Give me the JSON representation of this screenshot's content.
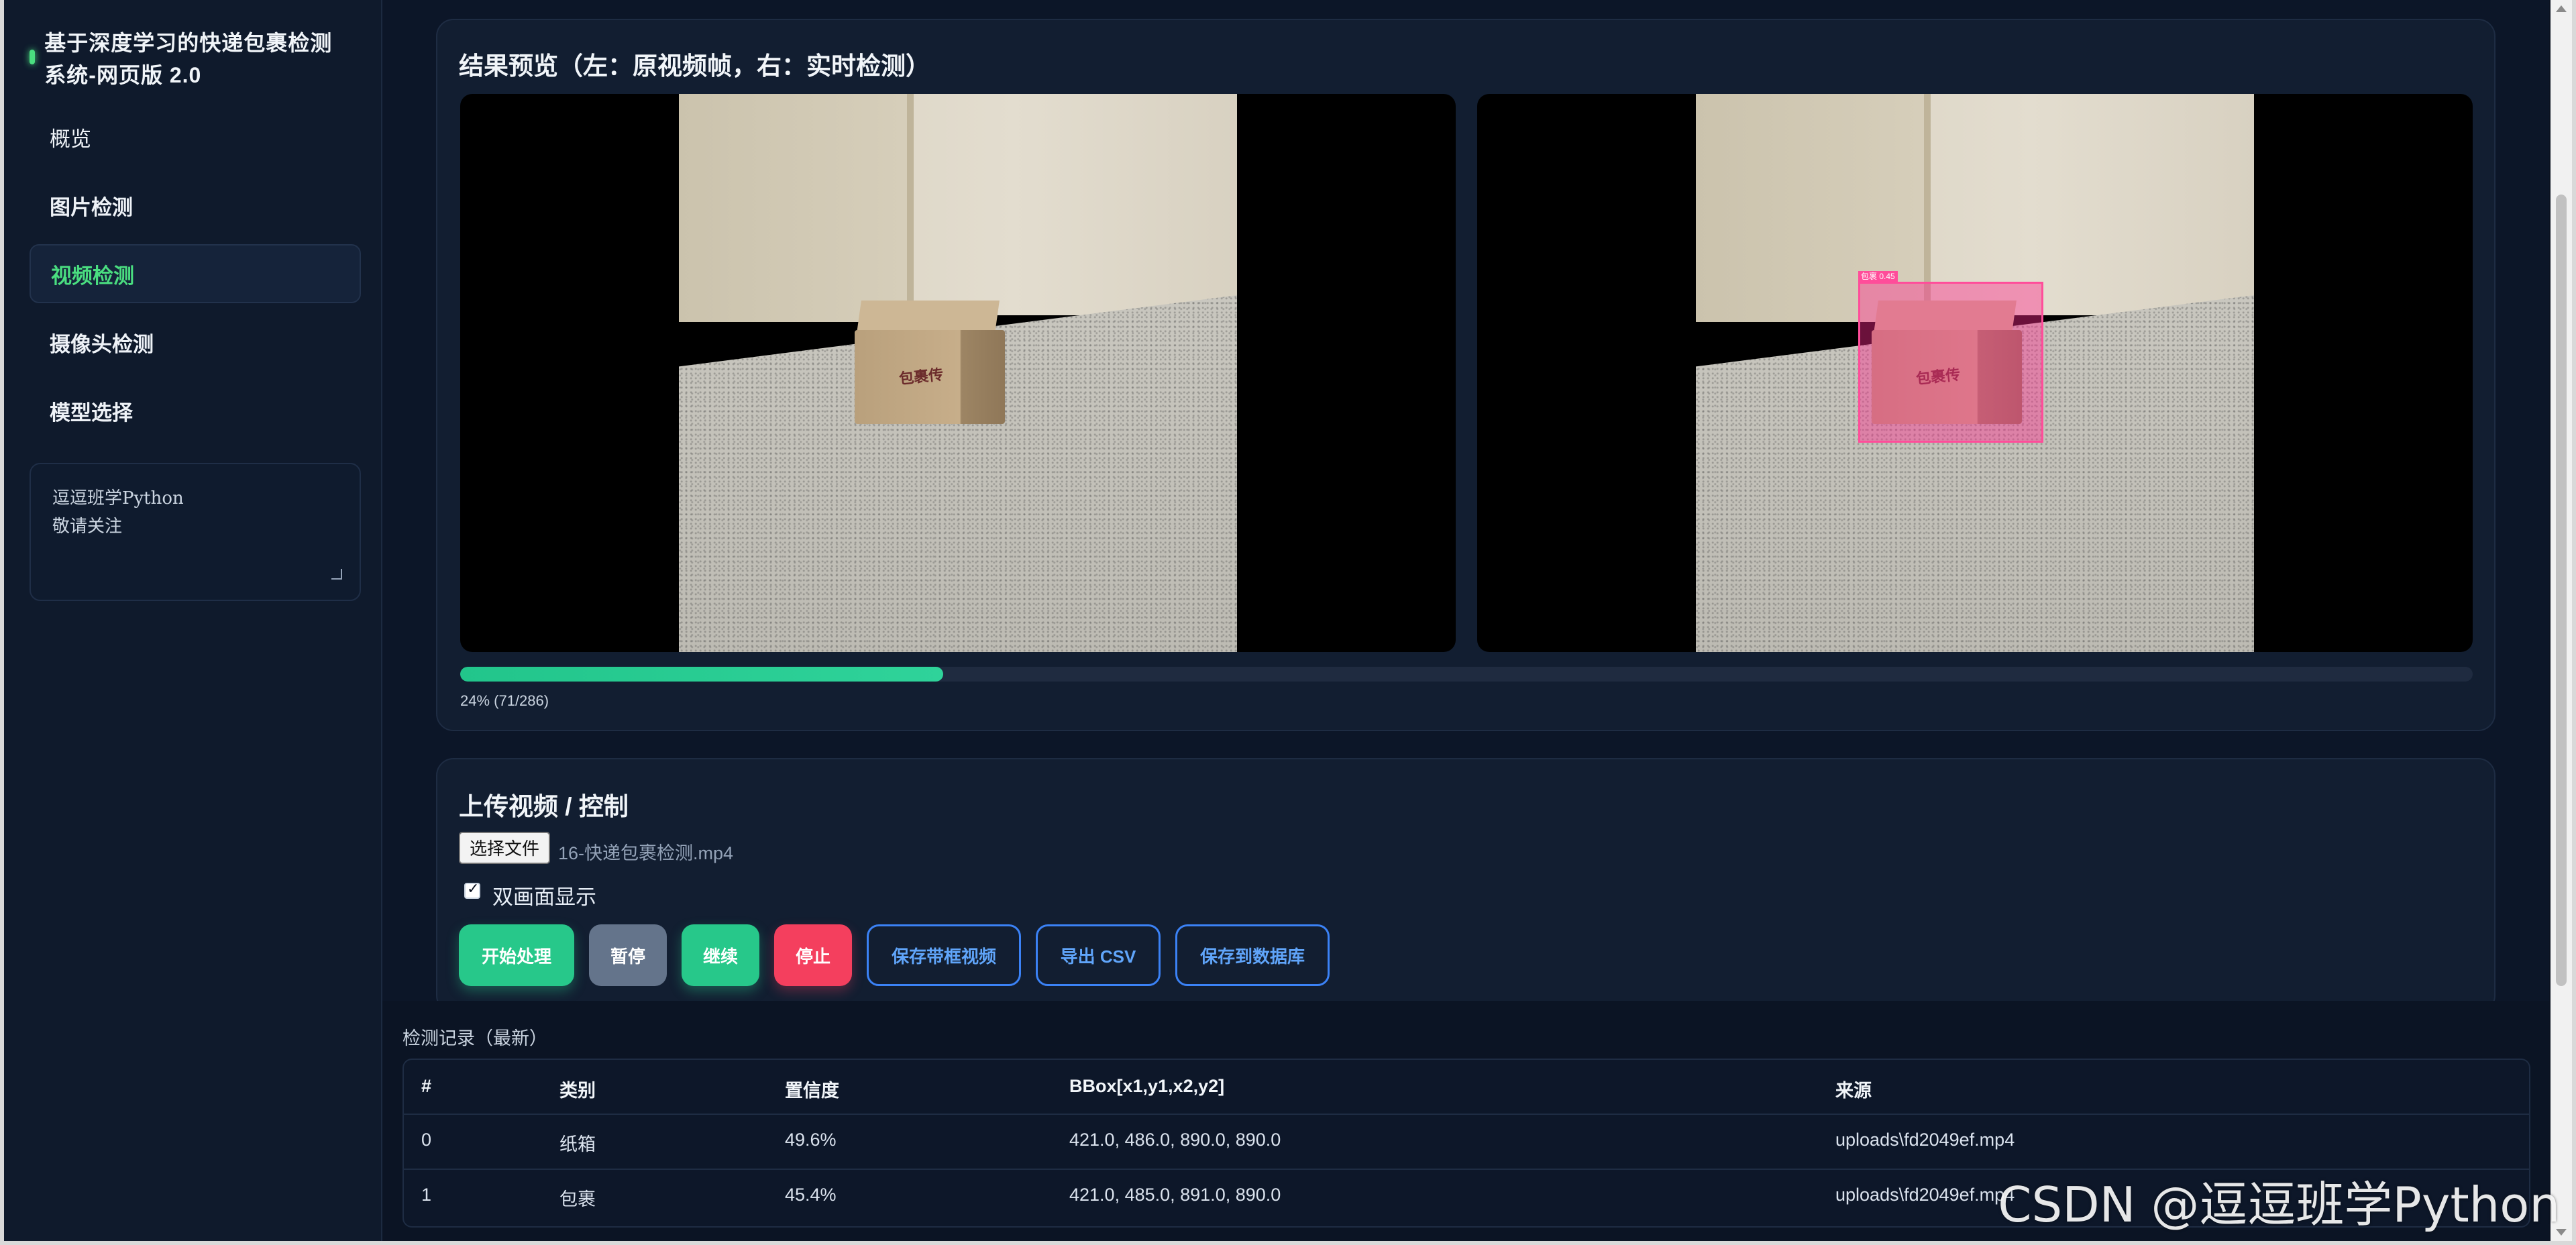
{
  "sidebar": {
    "title": "基于深度学习的快递包裹检测系统-网页版 2.0",
    "items": [
      {
        "label": "概览"
      },
      {
        "label": "图片检测"
      },
      {
        "label": "视频检测"
      },
      {
        "label": "摄像头检测"
      },
      {
        "label": "模型选择"
      }
    ],
    "note": "逗逗班学Python\n敬请关注"
  },
  "preview": {
    "title": "结果预览（左：原视频帧，右：实时检测）",
    "detection_label": "包裹 0.45",
    "progress_percent": 24,
    "progress_text": "24% (71/286)"
  },
  "upload": {
    "title": "上传视频 / 控制",
    "file_button": "选择文件",
    "file_name": "16-快递包裹检测.mp4",
    "dual_view_label": "双画面显示",
    "dual_view_checked": true,
    "buttons": {
      "start": "开始处理",
      "pause": "暂停",
      "resume": "继续",
      "stop": "停止",
      "save_video": "保存带框视频",
      "export_csv": "导出 CSV",
      "save_db": "保存到数据库"
    }
  },
  "records": {
    "title": "检测记录（最新）",
    "columns": [
      "#",
      "类别",
      "置信度",
      "BBox[x1,y1,x2,y2]",
      "来源"
    ],
    "rows": [
      [
        "0",
        "纸箱",
        "49.6%",
        "421.0, 486.0, 890.0, 890.0",
        "uploads\\fd2049ef.mp4"
      ],
      [
        "1",
        "包裹",
        "45.4%",
        "421.0, 485.0, 891.0, 890.0",
        "uploads\\fd2049ef.mp4"
      ]
    ]
  },
  "watermark": "CSDN @逗逗班学Python",
  "colors": {
    "accent": "#4ade80",
    "primary_button": "#27c88a",
    "danger_button": "#f43f5e",
    "outline_button": "#3b82f6",
    "detection_box": "#ff4d9a"
  }
}
